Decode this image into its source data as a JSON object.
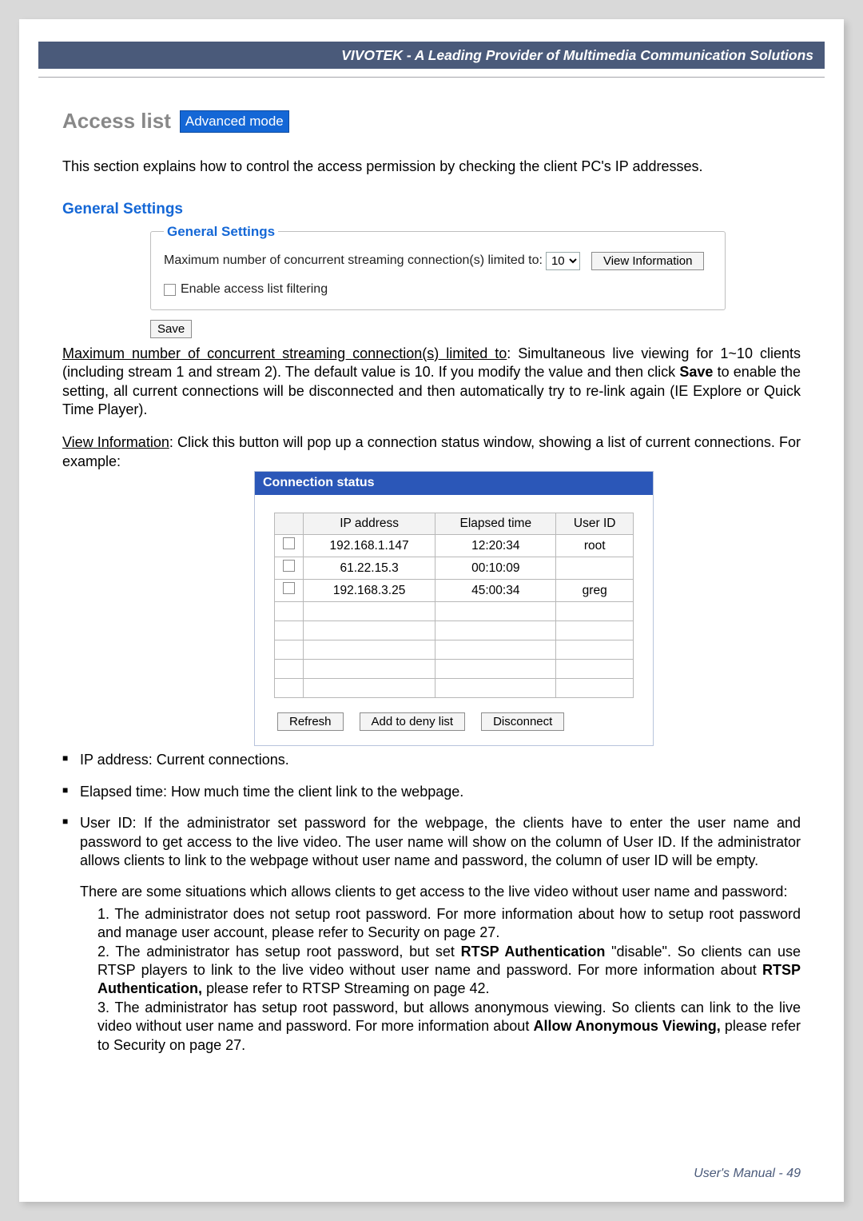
{
  "header": {
    "text": "VIVOTEK - A Leading Provider of Multimedia Communication Solutions"
  },
  "title": {
    "main": "Access list",
    "badge": "Advanced mode"
  },
  "intro": "This section explains how to control the access permission by checking the client PC's IP addresses.",
  "blue_heading": "General Settings",
  "fieldset": {
    "legend": "General Settings",
    "max_label": "Maximum number of concurrent streaming connection(s) limited to:",
    "max_value": "10",
    "view_btn": "View Information",
    "enable_label": "Enable access list filtering"
  },
  "save_btn": "Save",
  "para1": {
    "u": "Maximum number of concurrent streaming connection(s) limited to",
    "a": ": Simultaneous live viewing for 1~10 clients (including stream 1 and stream 2). The default value is 10. If you modify the value and then click ",
    "b": "Save",
    "c": " to enable the setting, all current connections will be disconnected and then automatically try to re-link again (IE Explore or Quick Time Player)."
  },
  "para2": {
    "u": "View Information",
    "a": ": Click this button will pop up a connection status window, showing a list of current connections. For example:"
  },
  "conn": {
    "title": "Connection status",
    "headers": [
      "IP address",
      "Elapsed time",
      "User ID"
    ],
    "rows": [
      {
        "ip": "192.168.1.147",
        "time": "12:20:34",
        "user": "root"
      },
      {
        "ip": "61.22.15.3",
        "time": "00:10:09",
        "user": ""
      },
      {
        "ip": "192.168.3.25",
        "time": "45:00:34",
        "user": "greg"
      }
    ],
    "btns": {
      "refresh": "Refresh",
      "add": "Add to deny list",
      "disc": "Disconnect"
    }
  },
  "bullets": {
    "b1": "IP address: Current connections.",
    "b2": "Elapsed time: How much time the client link to the webpage.",
    "b3a": "User ID: If the administrator set password for the webpage, the clients have to enter the user name and password to get access to the live video. The user name will show on the column of User ID. If the administrator allows clients to link to the webpage without user name and password, the column of user ID will be empty.",
    "b3b": "There are some situations which allows clients to get access to the live video without user name and password:",
    "n1": "1. The administrator does not setup root password. For more information about how to setup root password and manage user account, please refer to Security on page 27.",
    "n2a": "2. The administrator has setup root password, but set ",
    "n2b": "RTSP Authentication",
    "n2c": " \"disable\". So clients can use RTSP players to link to the live video without user name and password. For more information about ",
    "n2d": "RTSP Authentication,",
    "n2e": " please refer to RTSP Streaming on page 42.",
    "n3a": "3. The administrator has setup root password, but allows anonymous viewing. So clients can link to the live video without user name and password. For more information about ",
    "n3b": "Allow Anonymous Viewing,",
    "n3c": " please refer to Security on page 27."
  },
  "footer": {
    "label": "User's Manual - ",
    "page": "49"
  }
}
